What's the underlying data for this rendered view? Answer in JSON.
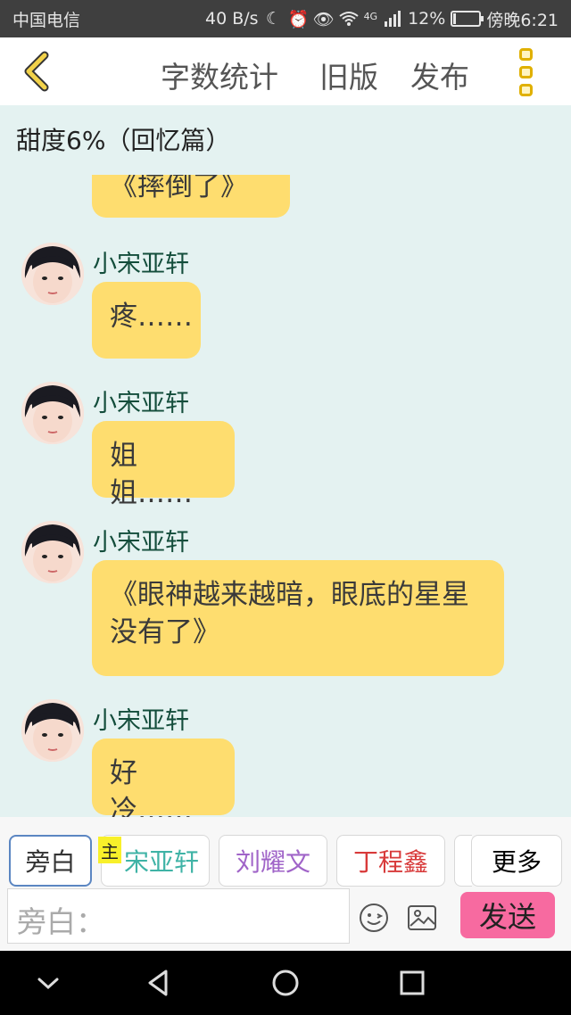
{
  "status_bar": {
    "carrier": "中国电信",
    "speed": "40 B/s",
    "network": "4G",
    "battery_percent": "12%",
    "battery_level": 0.12,
    "time": "傍晚6:21"
  },
  "header": {
    "buttons": [
      "字数统计",
      "旧版",
      "发布"
    ]
  },
  "chat_title": "甜度6%（回忆篇）",
  "messages": [
    {
      "text": "《摔倒了》"
    },
    {
      "sender": "小宋亚轩",
      "text": "疼……"
    },
    {
      "sender": "小宋亚轩",
      "text": "姐姐……"
    },
    {
      "sender": "小宋亚轩",
      "text": "《眼神越来越暗，眼底的星星没有了》"
    },
    {
      "sender": "小宋亚轩",
      "text": "好冷……"
    }
  ],
  "roles": [
    {
      "label": "旁白",
      "color": "#333333"
    },
    {
      "label": "宋亚轩",
      "color": "#3fb3a6"
    },
    {
      "label": "刘耀文",
      "color": "#a064c8"
    },
    {
      "label": "丁程鑫",
      "color": "#d83a3a"
    }
  ],
  "role_badge": "主",
  "more_label": "更多",
  "input": {
    "placeholder": "旁白："
  },
  "send_label": "发送",
  "icons": {
    "back": "chevron-left-icon",
    "menu": "kebab-menu-icon",
    "emoji": "emoji-icon",
    "image": "image-icon"
  },
  "colors": {
    "bubble": "#fedd6f",
    "accent": "#e0b000",
    "send": "#f76aa0",
    "chat_bg": "#e4f2f1"
  }
}
